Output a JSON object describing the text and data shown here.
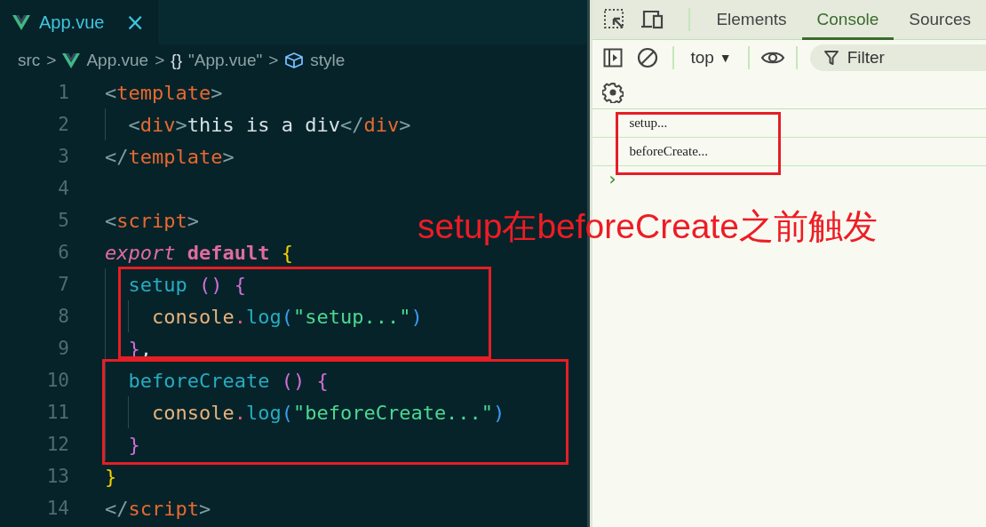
{
  "editor": {
    "tab": {
      "label": "App.vue",
      "close": "×",
      "selected": true
    },
    "breadcrumb": [
      {
        "kind": "text",
        "text": "src"
      },
      {
        "kind": "sep",
        "text": ">"
      },
      {
        "kind": "vue",
        "text": "App.vue"
      },
      {
        "kind": "sep",
        "text": ">"
      },
      {
        "kind": "braces",
        "text": "{}"
      },
      {
        "kind": "text",
        "text": "\"App.vue\""
      },
      {
        "kind": "sep",
        "text": ">"
      },
      {
        "kind": "cube",
        "text": "style"
      }
    ],
    "lines": [
      {
        "number": "1",
        "tokens": [
          {
            "kind": "punct",
            "text": "<"
          },
          {
            "kind": "tag",
            "text": "template"
          },
          {
            "kind": "punct",
            "text": ">"
          }
        ]
      },
      {
        "number": "2",
        "tokens": [
          {
            "kind": "guide"
          },
          {
            "kind": "punct",
            "text": "<"
          },
          {
            "kind": "tag",
            "text": "div"
          },
          {
            "kind": "punct",
            "text": ">"
          },
          {
            "kind": "plain",
            "text": "this is a div"
          },
          {
            "kind": "punct",
            "text": "</"
          },
          {
            "kind": "tag",
            "text": "div"
          },
          {
            "kind": "punct",
            "text": ">"
          }
        ]
      },
      {
        "number": "3",
        "tokens": [
          {
            "kind": "punct",
            "text": "</"
          },
          {
            "kind": "tag",
            "text": "template"
          },
          {
            "kind": "punct",
            "text": ">"
          }
        ]
      },
      {
        "number": "4"
      },
      {
        "number": "5",
        "tokens": [
          {
            "kind": "punct",
            "text": "<"
          },
          {
            "kind": "tag",
            "text": "script"
          },
          {
            "kind": "punct",
            "text": ">"
          }
        ]
      },
      {
        "number": "6",
        "tokens": [
          {
            "kind": "keyword",
            "text": "export "
          },
          {
            "kind": "storage",
            "text": "default "
          },
          {
            "kind": "brace",
            "text": "{"
          }
        ]
      },
      {
        "number": "7",
        "tokens": [
          {
            "kind": "guide"
          },
          {
            "kind": "method",
            "text": "setup "
          },
          {
            "kind": "paren",
            "text": "() "
          },
          {
            "kind": "inner",
            "text": "{"
          }
        ]
      },
      {
        "number": "8",
        "tokens": [
          {
            "kind": "guide"
          },
          {
            "kind": "guide"
          },
          {
            "kind": "object",
            "text": "console"
          },
          {
            "kind": "dot",
            "text": "."
          },
          {
            "kind": "method",
            "text": "log"
          },
          {
            "kind": "call",
            "text": "("
          },
          {
            "kind": "string",
            "text": "\"setup...\""
          },
          {
            "kind": "call",
            "text": ")"
          }
        ]
      },
      {
        "number": "9",
        "tokens": [
          {
            "kind": "guide"
          },
          {
            "kind": "inner",
            "text": "}"
          },
          {
            "kind": "plain",
            "text": ","
          }
        ]
      },
      {
        "number": "10",
        "tokens": [
          {
            "kind": "guide"
          },
          {
            "kind": "method",
            "text": "beforeCreate "
          },
          {
            "kind": "paren",
            "text": "() "
          },
          {
            "kind": "inner",
            "text": "{"
          }
        ]
      },
      {
        "number": "11",
        "tokens": [
          {
            "kind": "guide"
          },
          {
            "kind": "guide"
          },
          {
            "kind": "object",
            "text": "console"
          },
          {
            "kind": "dot",
            "text": "."
          },
          {
            "kind": "method",
            "text": "log"
          },
          {
            "kind": "call",
            "text": "("
          },
          {
            "kind": "string",
            "text": "\"beforeCreate...\""
          },
          {
            "kind": "call",
            "text": ")"
          }
        ]
      },
      {
        "number": "12",
        "tokens": [
          {
            "kind": "guide"
          },
          {
            "kind": "inner",
            "text": "}"
          }
        ]
      },
      {
        "number": "13",
        "tokens": [
          {
            "kind": "brace",
            "text": "}"
          }
        ]
      },
      {
        "number": "14",
        "tokens": [
          {
            "kind": "punct",
            "text": "</"
          },
          {
            "kind": "tag",
            "text": "script"
          },
          {
            "kind": "punct",
            "text": ">"
          }
        ]
      }
    ]
  },
  "devtools": {
    "tabs": [
      {
        "label": "Elements",
        "selected": false
      },
      {
        "label": "Console",
        "selected": true
      },
      {
        "label": "Sources",
        "selected": false
      }
    ],
    "context": {
      "label": "top",
      "caret": "▼"
    },
    "filter": {
      "placeholder": "Filter"
    },
    "messages": [
      "setup...",
      "beforeCreate..."
    ],
    "prompt": "›"
  },
  "annotation": "setup在beforeCreate之前触发"
}
